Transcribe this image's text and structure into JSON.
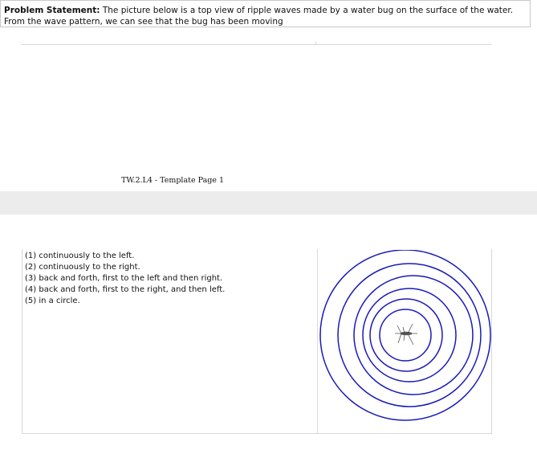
{
  "problem": {
    "label": "Problem Statement:",
    "text": " The picture below is a top view of ripple waves made by a water bug on the surface of the water.  From the wave pattern, we can see that the bug has been moving"
  },
  "footer": "TW.2.L4 - Template Page 1",
  "options": [
    "(1) continuously to the left.",
    "(2) continuously to the right.",
    "(3) back and forth, first to the left and then right.",
    "(4) back and forth, first to the right, and then left.",
    "(5) in a circle."
  ],
  "figure": {
    "ring_color": "#1a1ab8",
    "bug_color": "#555555",
    "bug_icon": "water-bug-icon"
  }
}
